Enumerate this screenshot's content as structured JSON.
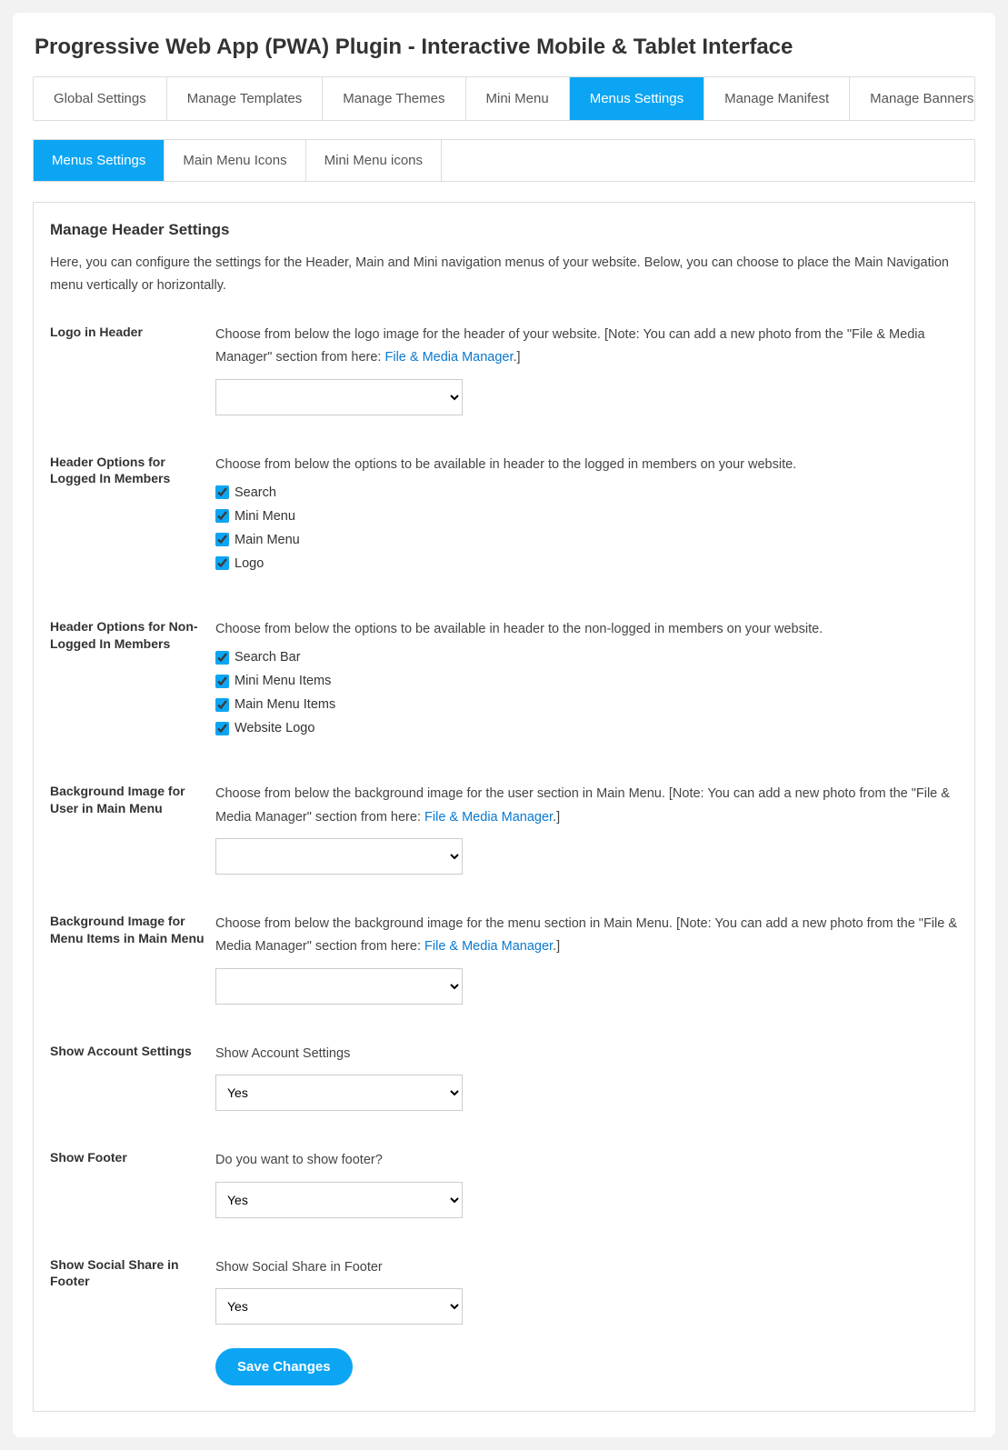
{
  "page": {
    "title": "Progressive Web App (PWA) Plugin - Interactive Mobile & Tablet Interface"
  },
  "tabs": {
    "main": [
      {
        "label": "Global Settings",
        "active": false
      },
      {
        "label": "Manage Templates",
        "active": false
      },
      {
        "label": "Manage Themes",
        "active": false
      },
      {
        "label": "Mini Menu",
        "active": false
      },
      {
        "label": "Menus Settings",
        "active": true
      },
      {
        "label": "Manage Manifest",
        "active": false
      },
      {
        "label": "Manage Banners",
        "active": false
      }
    ],
    "sub": [
      {
        "label": "Menus Settings",
        "active": true
      },
      {
        "label": "Main Menu Icons",
        "active": false
      },
      {
        "label": "Mini Menu icons",
        "active": false
      }
    ]
  },
  "panel": {
    "heading": "Manage Header Settings",
    "intro": "Here, you can configure the settings for the Header, Main and Mini navigation menus of your website. Below, you can choose to place the Main Navigation menu vertically or horizontally."
  },
  "fields": {
    "logo_header": {
      "label": "Logo in Header",
      "desc_before": "Choose from below the logo image for the header of your website. [Note: You can add a new photo from the \"File & Media Manager\" section from here: ",
      "link": "File & Media Manager",
      "desc_after": ".]",
      "value": ""
    },
    "header_logged_in": {
      "label": "Header Options for Logged In Members",
      "desc": "Choose from below the options to be available in header to the logged in members on your website.",
      "options": [
        "Search",
        "Mini Menu",
        "Main Menu",
        "Logo"
      ]
    },
    "header_non_logged": {
      "label": "Header Options for Non-Logged In Members",
      "desc": "Choose from below the options to be available in header to the non-logged in members on your website.",
      "options": [
        "Search Bar",
        "Mini Menu Items",
        "Main Menu Items",
        "Website Logo"
      ]
    },
    "bg_user": {
      "label": "Background Image for User in Main Menu",
      "desc_before": "Choose from below the background image for the user section in Main Menu. [Note: You can add a new photo from the \"File & Media Manager\" section from here: ",
      "link": "File & Media Manager",
      "desc_after": ".]",
      "value": ""
    },
    "bg_menu": {
      "label": "Background Image for Menu Items in Main Menu",
      "desc_before": "Choose from below the background image for the menu section in Main Menu. [Note: You can add a new photo from the \"File & Media Manager\" section from here: ",
      "link": "File & Media Manager",
      "desc_after": ".]",
      "value": ""
    },
    "show_account": {
      "label": "Show Account Settings",
      "desc": "Show Account Settings",
      "value": "Yes"
    },
    "show_footer": {
      "label": "Show Footer",
      "desc": "Do you want to show footer?",
      "value": "Yes"
    },
    "show_social": {
      "label": "Show Social Share in Footer",
      "desc": "Show Social Share in Footer",
      "value": "Yes"
    }
  },
  "buttons": {
    "save": "Save Changes"
  }
}
